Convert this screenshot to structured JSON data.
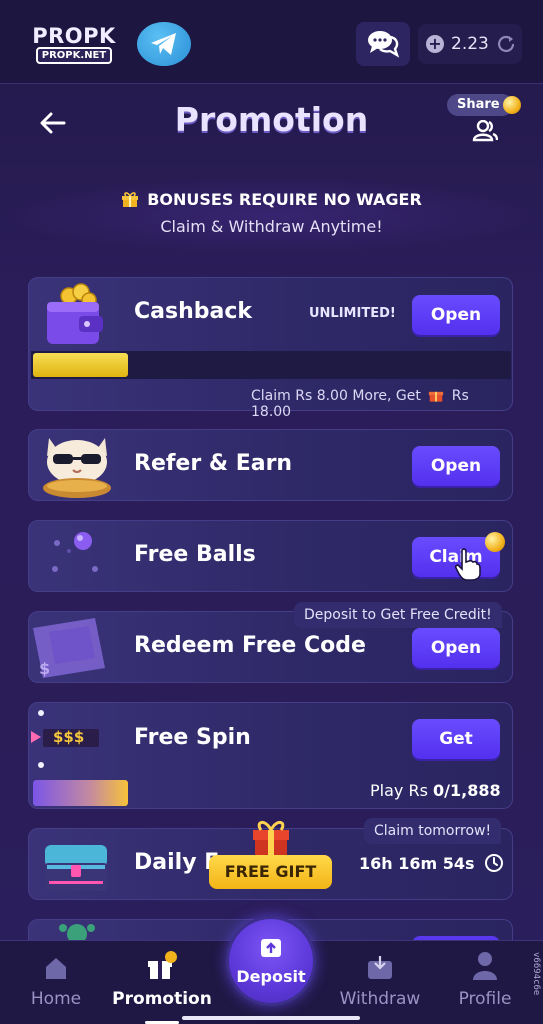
{
  "topbar": {
    "logo_main": "PROPK",
    "logo_sub": "PROPK.NET",
    "balance": "2.23"
  },
  "header": {
    "title": "Promotion",
    "share_label": "Share"
  },
  "banner": {
    "line1": "BONUSES REQUIRE NO WAGER",
    "line2": "Claim & Withdraw Anytime!"
  },
  "cards": {
    "cashback": {
      "label": "Cashback",
      "badge": "UNLIMITED!",
      "button": "Open",
      "progress_fraction": 0.2,
      "note_prefix": "Claim Rs 8.00 More, Get",
      "note_suffix": "Rs 18.00"
    },
    "refer": {
      "label": "Refer & Earn",
      "button": "Open"
    },
    "balls": {
      "label": "Free Balls",
      "button": "Claim"
    },
    "redeem": {
      "label": "Redeem Free Code",
      "button": "Open",
      "tag": "Deposit to Get Free Credit!"
    },
    "spin": {
      "label": "Free Spin",
      "button": "Get",
      "icon_text": "$$$",
      "progress_fraction": 0.2,
      "play_prefix": "Play Rs ",
      "play_value": "0/1,888"
    },
    "daily": {
      "label": "Daily F",
      "tag": "Claim tomorrow!",
      "timer": "16h 16m 54s"
    }
  },
  "free_gift": "FREE GIFT",
  "nav": {
    "home": "Home",
    "promotion": "Promotion",
    "deposit": "Deposit",
    "withdraw": "Withdraw",
    "profile": "Profile"
  },
  "version": "v6694c6e",
  "colors": {
    "accent": "#5a38f0",
    "gold": "#f2c21f",
    "background": "#2a1d5a"
  }
}
